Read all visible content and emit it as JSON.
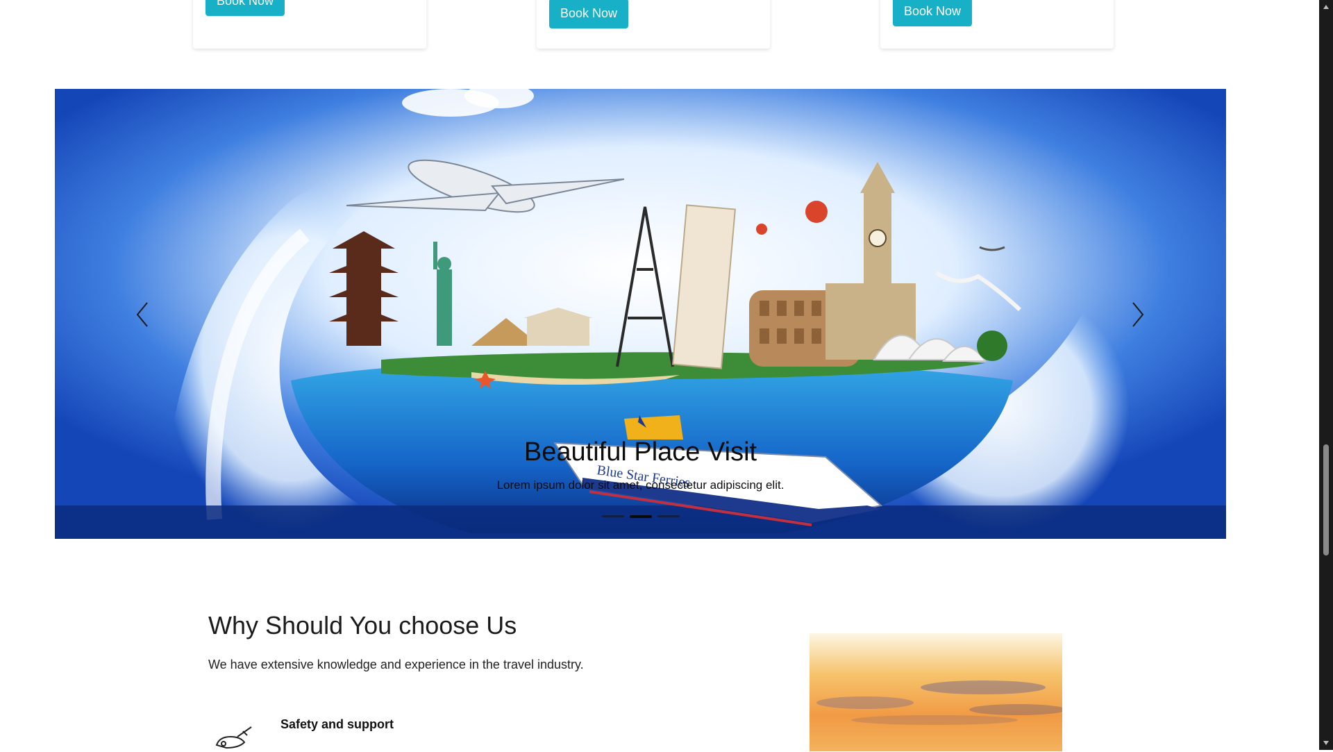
{
  "cards": [
    {
      "button_label": "Book Now"
    },
    {
      "button_label": "Book Now"
    },
    {
      "button_label": "Book Now"
    }
  ],
  "carousel": {
    "caption_title": "Beautiful Place Visit",
    "caption_text": "Lorem ipsum dolor sit amet, consectetur adipiscing elit.",
    "ship_text": "Blue Star Ferries",
    "slide_count": 3,
    "active_slide": 2
  },
  "why": {
    "title": "Why Should You choose Us",
    "subtitle": "We have extensive knowledge and experience in the travel industry.",
    "feature_title": "Safety and support"
  },
  "colors": {
    "accent": "#17b0c6",
    "sea": "#1f5fc4",
    "sky": "#e9f3ff"
  }
}
